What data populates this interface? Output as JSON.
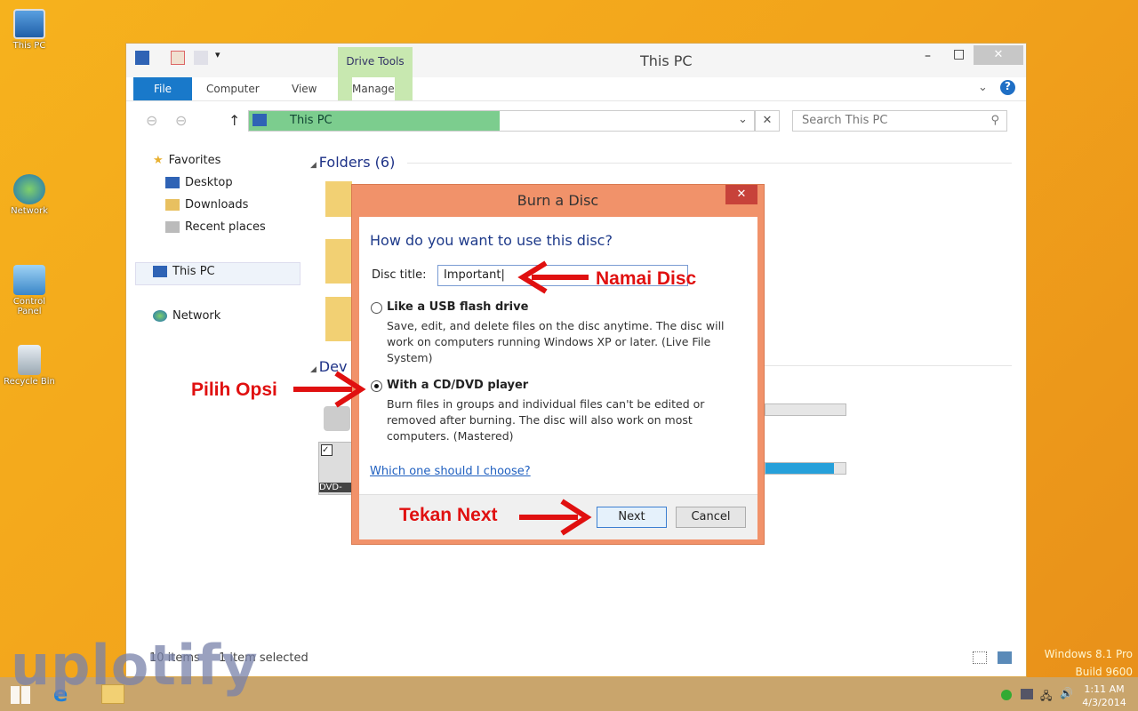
{
  "desktop": {
    "icons": [
      "This PC",
      "Network",
      "Control Panel",
      "Recycle Bin"
    ],
    "edition": "Windows 8.1 Pro",
    "build": "Build 9600"
  },
  "explorer": {
    "title": "This PC",
    "contextual_tab_group": "Drive Tools",
    "tabs": [
      "File",
      "Computer",
      "View",
      "Manage"
    ],
    "address": "This PC",
    "search_placeholder": "Search This PC",
    "nav": {
      "favorites": "Favorites",
      "desktop": "Desktop",
      "downloads": "Downloads",
      "recent": "Recent places",
      "this_pc": "This PC",
      "network": "Network"
    },
    "folders_header": "Folders (6)",
    "devices_header": "Dev",
    "drive_label": "DVD-",
    "drive_usage": [
      0.0,
      0.85
    ],
    "status_items": "10 items",
    "status_selected": "1 item selected"
  },
  "dialog": {
    "title": "Burn a Disc",
    "question": "How do you want to use this disc?",
    "disc_title_label": "Disc title:",
    "disc_title_value": "Important",
    "option1": {
      "label": "Like a USB flash drive",
      "desc": "Save, edit, and delete files on the disc anytime. The disc will work on computers running Windows XP or later. (Live File System)",
      "selected": false
    },
    "option2": {
      "label": "With a CD/DVD player",
      "desc": "Burn files in groups and individual files can't be edited or removed after burning. The disc will also work on most computers. (Mastered)",
      "selected": true
    },
    "help_link": "Which one should I choose?",
    "next": "Next",
    "cancel": "Cancel"
  },
  "annotations": {
    "name_disc": "Namai Disc",
    "choose_option": "Pilih Opsi",
    "press_next": "Tekan Next",
    "color": "#e01010"
  },
  "watermark": "uplotify",
  "taskbar": {
    "time": "1:11 AM",
    "date": "4/3/2014"
  }
}
